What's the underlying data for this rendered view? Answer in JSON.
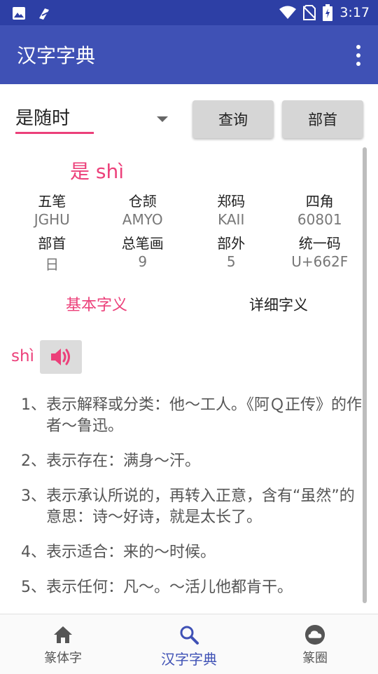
{
  "status_bar": {
    "time": "3:17"
  },
  "app_bar": {
    "title": "汉字字典"
  },
  "search": {
    "value": "是随时",
    "query_button": "查询",
    "radical_button": "部首"
  },
  "character": {
    "heading": "是 shì",
    "rows": [
      [
        "五笔",
        "仓颉",
        "郑码",
        "四角"
      ],
      [
        "JGHU",
        "AMYO",
        "KAII",
        "60801"
      ],
      [
        "部首",
        "总笔画",
        "部外",
        "统一码"
      ],
      [
        "日",
        "9",
        "5",
        "U+662F"
      ]
    ]
  },
  "tabs": {
    "basic": "基本字义",
    "detailed": "详细字义"
  },
  "pinyin": "shì",
  "definitions": [
    "1、表示解释或分类：他～工人。《阿Ｑ正传》的作者～鲁迅。",
    "2、表示存在：满身～汗。",
    "3、表示承认所说的，再转入正意，含有“虽然”的意思：诗～好诗，就是太长了。",
    "4、表示适合：来的～时候。",
    "5、表示任何：凡～。～活儿他都肯干。"
  ],
  "bottom_nav": [
    {
      "label": "篆体字",
      "icon": "home-icon"
    },
    {
      "label": "汉字字典",
      "icon": "search-icon",
      "active": true
    },
    {
      "label": "篆圈",
      "icon": "cloud-icon"
    }
  ],
  "colors": {
    "primary": "#3f51b5",
    "primary_dark": "#2d3fa5",
    "accent": "#ec407a"
  }
}
